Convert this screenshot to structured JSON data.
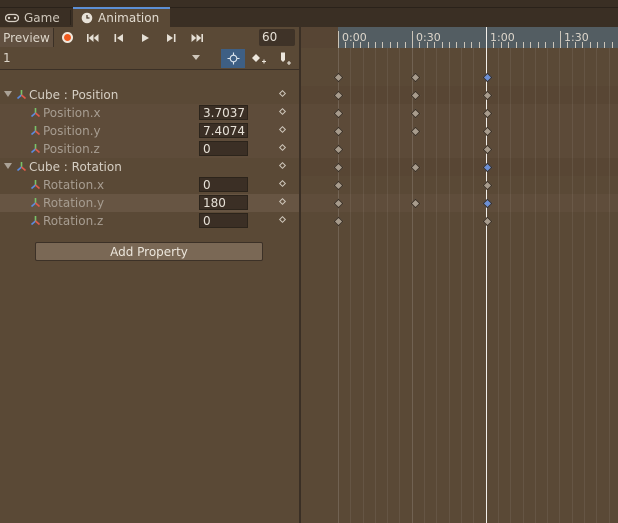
{
  "tabs": [
    {
      "label": "Game",
      "icon": "gamepad-icon"
    },
    {
      "label": "Animation",
      "icon": "clock-icon"
    }
  ],
  "toolbar": {
    "preview_label": "Preview",
    "frame_value": "60"
  },
  "clip": {
    "selected": "1"
  },
  "timeline": {
    "ticks": [
      "0:00",
      "0:30",
      "1:00",
      "1:30"
    ]
  },
  "properties": [
    {
      "label": "Cube : Position",
      "kind": "group",
      "value": ""
    },
    {
      "label": "Position.x",
      "kind": "child",
      "value": "3.7037"
    },
    {
      "label": "Position.y",
      "kind": "child",
      "value": "7.4074"
    },
    {
      "label": "Position.z",
      "kind": "child",
      "value": "0"
    },
    {
      "label": "Cube : Rotation",
      "kind": "group",
      "value": ""
    },
    {
      "label": "Rotation.x",
      "kind": "child",
      "value": "0"
    },
    {
      "label": "Rotation.y",
      "kind": "child",
      "value": "180"
    },
    {
      "label": "Rotation.z",
      "kind": "child",
      "value": "0"
    }
  ],
  "add_property_label": "Add Property",
  "colors": {
    "background": "#5a4936",
    "record": "#f05a1e",
    "selected_key": "#6c8fd4",
    "key": "#a79b8c",
    "accent_tab": "#5c8fd6"
  }
}
